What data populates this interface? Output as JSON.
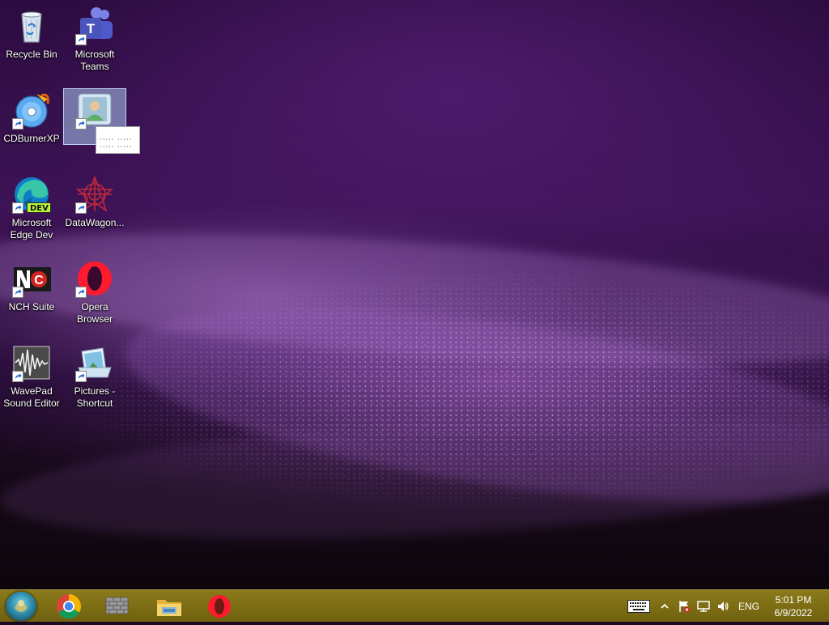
{
  "desktop": {
    "icons": [
      {
        "id": "recycle-bin",
        "label": "Recycle Bin",
        "icon": "recycle-bin-icon",
        "shortcut": false
      },
      {
        "id": "microsoft-teams",
        "label": "Microsoft Teams",
        "icon": "teams-icon",
        "shortcut": true
      },
      {
        "id": "cdburnerxp",
        "label": "CDBurnerXP",
        "icon": "cd-burner-icon",
        "shortcut": true
      },
      {
        "id": "selected-item",
        "label": "",
        "icon": "user-contact-icon",
        "shortcut": true,
        "selected": true
      },
      {
        "id": "edge-dev",
        "label": "Microsoft Edge Dev",
        "icon": "edge-dev-icon",
        "shortcut": true,
        "badge": "DEV"
      },
      {
        "id": "datawagon",
        "label": "DataWagon...",
        "icon": "datawagon-icon",
        "shortcut": true
      },
      {
        "id": "nch-suite",
        "label": "NCH Suite",
        "icon": "nch-suite-icon",
        "shortcut": true
      },
      {
        "id": "opera-browser",
        "label": "Opera Browser",
        "icon": "opera-icon",
        "shortcut": true
      },
      {
        "id": "wavepad",
        "label": "WavePad Sound Editor",
        "icon": "wavepad-icon",
        "shortcut": true
      },
      {
        "id": "pictures-shortcut",
        "label": "Pictures - Shortcut",
        "icon": "pictures-folder-icon",
        "shortcut": true
      }
    ],
    "drag_tooltip_text": ",,,,, ,,,,,  ,,,,, ,,,,,"
  },
  "taskbar": {
    "start_icon": "start-orb-icon",
    "pinned_apps": [
      {
        "id": "chrome",
        "icon": "chrome-icon"
      },
      {
        "id": "wall-app",
        "icon": "brick-wall-icon"
      },
      {
        "id": "file-explorer",
        "icon": "file-explorer-icon"
      },
      {
        "id": "opera",
        "icon": "opera-icon"
      }
    ],
    "tray": {
      "keyboard_icon": "touch-keyboard-icon",
      "chevron_icon": "show-hidden-icons-chevron",
      "action_center_icon": "action-center-flag-icon",
      "network_icon": "network-icon",
      "volume_icon": "volume-icon",
      "language": "ENG",
      "time": "5:01 PM",
      "date": "6/9/2022"
    }
  },
  "colors": {
    "taskbar": "#7d6e14",
    "wallpaper_dark": "#2c0c40",
    "wallpaper_glow": "#b77ad6"
  }
}
